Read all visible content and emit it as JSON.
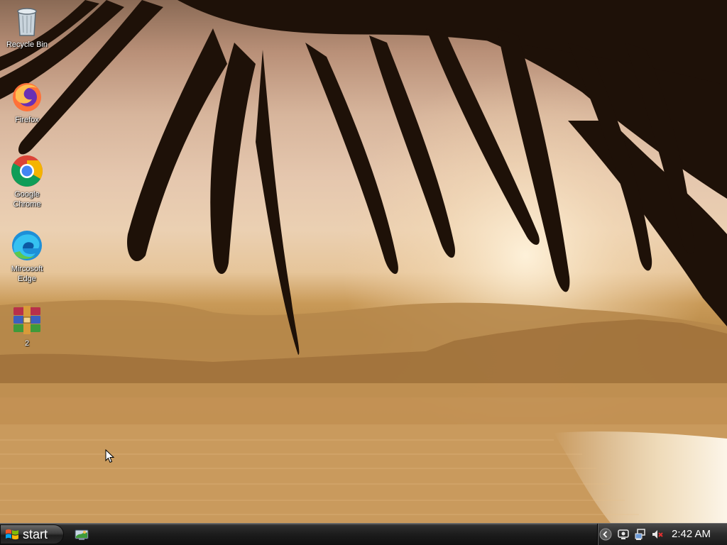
{
  "desktop": {
    "icons": [
      {
        "label": "Recycle Bin",
        "icon": "recycle-bin-icon"
      },
      {
        "label": "Firefox",
        "icon": "firefox-icon"
      },
      {
        "label": "Google Chrome",
        "icon": "chrome-icon"
      },
      {
        "label": "Mircosoft Edge",
        "icon": "edge-icon"
      },
      {
        "label": "2",
        "icon": "winrar-archive-icon"
      }
    ],
    "wallpaper": "palm-tree-beach-sunset"
  },
  "taskbar": {
    "start_label": "start",
    "quick_launch": [
      "show-desktop-icon"
    ],
    "tray_icons": [
      "chevron-left-icon",
      "network-icon",
      "safely-remove-hardware-icon",
      "volume-muted-icon"
    ],
    "clock": "2:42 AM"
  },
  "colors": {
    "taskbar": "#1c1c1c",
    "sky": "#e5c7ae",
    "water": "#cc9c5f"
  }
}
